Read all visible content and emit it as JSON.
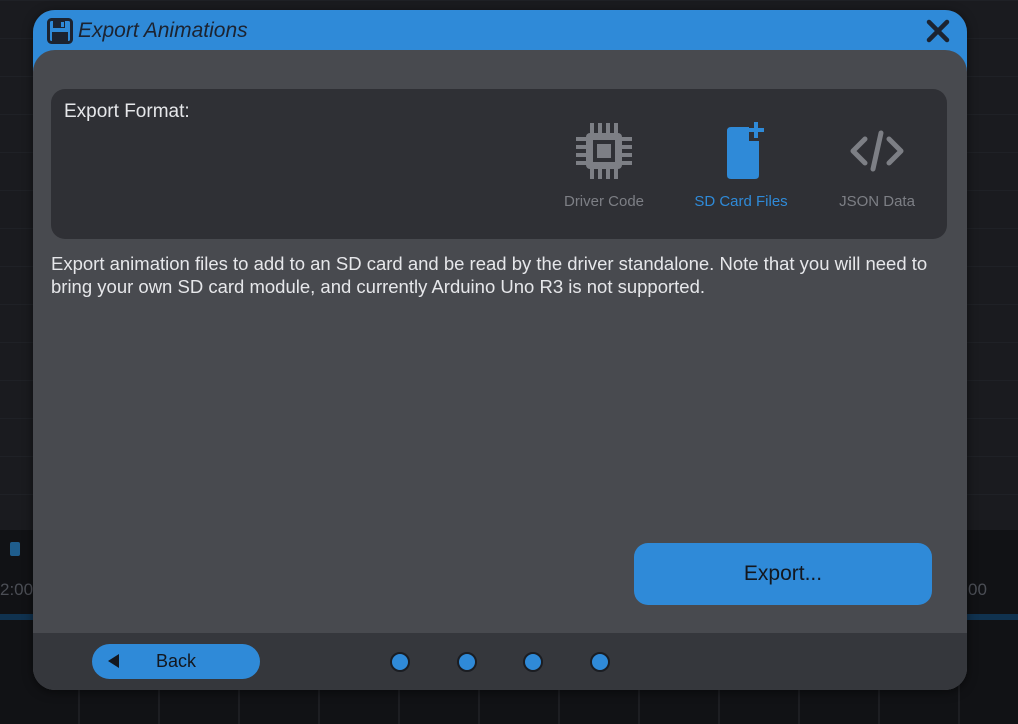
{
  "background": {
    "time_left": "2:00",
    "time_right": "00"
  },
  "dialog": {
    "title": "Export Animations",
    "accent_color": "#2f8ad8",
    "icons": {
      "title": "floppy-disk-icon",
      "close": "close-icon"
    },
    "format": {
      "label": "Export Format:",
      "options": [
        {
          "label": "Driver Code",
          "icon": "chip-icon",
          "selected": false
        },
        {
          "label": "SD Card Files",
          "icon": "file-add-icon",
          "selected": true
        },
        {
          "label": "JSON Data",
          "icon": "code-icon",
          "selected": false
        }
      ]
    },
    "description": "Export animation files to add to an SD card and be read by the driver standalone. Note that you will need to bring your own SD card module, and currently Arduino Uno R3 is not supported.",
    "export_button": "Export...",
    "footer": {
      "back_label": "Back",
      "page_dots": 4
    }
  }
}
